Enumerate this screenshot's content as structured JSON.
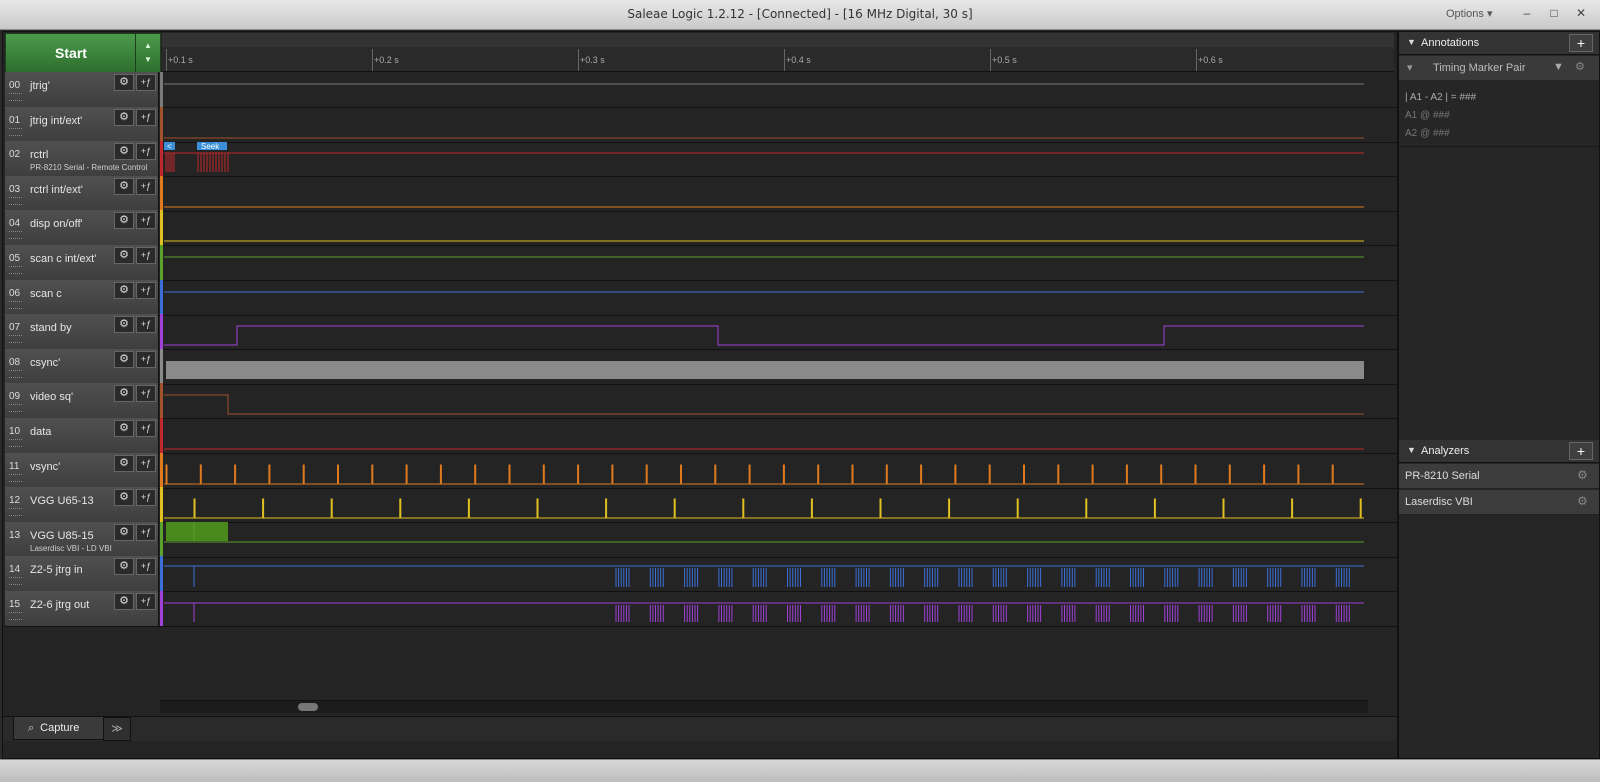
{
  "window": {
    "title": "Saleae Logic 1.2.12 - [Connected] - [16 MHz Digital, 30 s]",
    "options_label": "Options ▾",
    "min_label": "–",
    "max_label": "□",
    "close_label": "✕"
  },
  "toolbar": {
    "start_label": "Start",
    "arrows_up": "▲",
    "arrows_down": "▼"
  },
  "ruler": {
    "ticks": [
      "+0.1 s",
      "+0.2 s",
      "+0.3 s",
      "+0.4 s",
      "+0.5 s",
      "+0.6 s"
    ]
  },
  "channels": [
    {
      "num": "00",
      "name": "jtrig'",
      "sub": "",
      "color": "#7a7a7a"
    },
    {
      "num": "01",
      "name": "jtrig int/ext'",
      "sub": "",
      "color": "#a0522d"
    },
    {
      "num": "02",
      "name": "rctrl",
      "sub": "PR-8210 Serial - Remote Control",
      "color": "#c0282d"
    },
    {
      "num": "03",
      "name": "rctrl int/ext'",
      "sub": "",
      "color": "#e07a1f"
    },
    {
      "num": "04",
      "name": "disp on/off'",
      "sub": "",
      "color": "#e0c020"
    },
    {
      "num": "05",
      "name": "scan c int/ext'",
      "sub": "",
      "color": "#5aa02c"
    },
    {
      "num": "06",
      "name": "scan c",
      "sub": "",
      "color": "#3a6fd8"
    },
    {
      "num": "07",
      "name": "stand by",
      "sub": "",
      "color": "#a040d8"
    },
    {
      "num": "08",
      "name": "csync'",
      "sub": "",
      "color": "#8a8a8a"
    },
    {
      "num": "09",
      "name": "video sq'",
      "sub": "",
      "color": "#a0522d"
    },
    {
      "num": "10",
      "name": "data",
      "sub": "",
      "color": "#c0282d"
    },
    {
      "num": "11",
      "name": "vsync'",
      "sub": "",
      "color": "#e07a1f"
    },
    {
      "num": "12",
      "name": "VGG U65-13",
      "sub": "",
      "color": "#e0c020"
    },
    {
      "num": "13",
      "name": "VGG U85-15",
      "sub": "Laserdisc VBI - LD VBI",
      "color": "#5aa02c"
    },
    {
      "num": "14",
      "name": "Z2-5 jtrg in",
      "sub": "",
      "color": "#3a6fd8"
    },
    {
      "num": "15",
      "name": "Z2-6 jtrg out",
      "sub": "",
      "color": "#a040d8"
    }
  ],
  "decode": {
    "small_label": "<",
    "seek_label": "Seek"
  },
  "icons": {
    "gear": "gear-icon",
    "trigger": "trigger-icon"
  },
  "gear_glyph": "⚙",
  "trig_glyph": "+ƒ",
  "capture_tab": {
    "label": "Capture",
    "icon": "capture-icon"
  },
  "more_tab": "≫",
  "annotations": {
    "title": "Annotations",
    "marker_pair": "Timing Marker Pair",
    "line1": "| A1 - A2 | = ###",
    "line2": "A1  @  ###",
    "line3": "A2  @  ###"
  },
  "analyzers": {
    "title": "Analyzers",
    "items": [
      "PR-8210 Serial",
      "Laserdisc VBI"
    ]
  }
}
